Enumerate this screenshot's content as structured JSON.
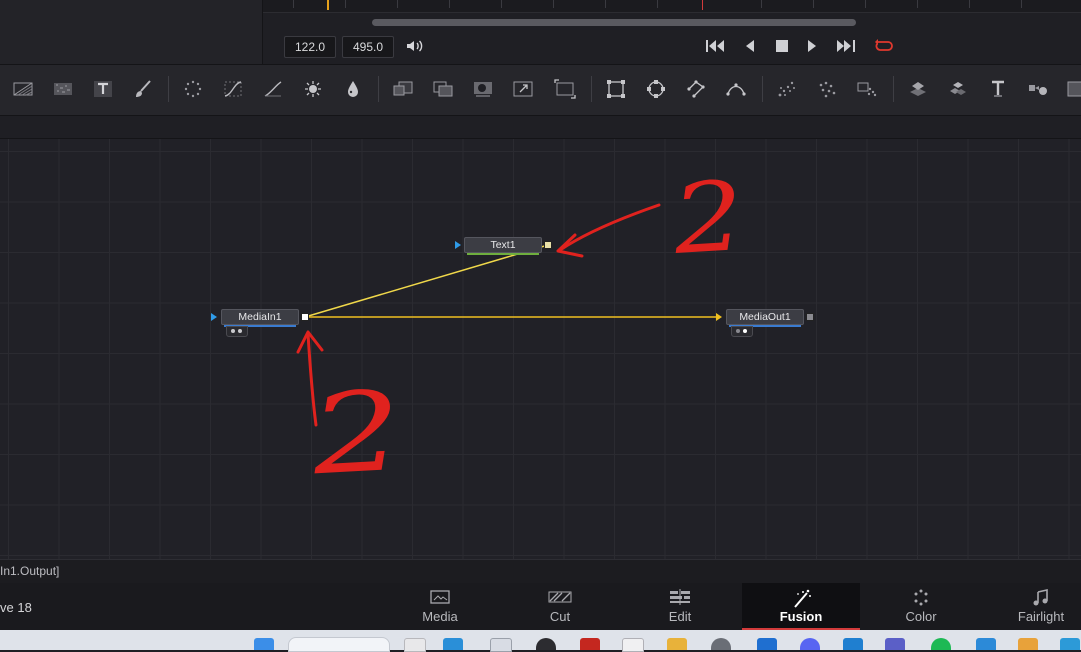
{
  "playback": {
    "current_frame": "122.0",
    "end_frame": "495.0"
  },
  "toolbar": {
    "tools": [
      "background-tool-icon",
      "fast-noise-tool-icon",
      "text-tool-icon",
      "paint-tool-icon",
      "particles-tool-icon",
      "color-curves-tool-icon",
      "color-corrector-tool-icon",
      "brightness-tool-icon",
      "blur-tool-icon",
      "loader-tool-icon",
      "merge-tool-icon",
      "matte-control-tool-icon",
      "transform-tool-icon",
      "resize-tool-icon",
      "rectangle-mask-icon",
      "ellipse-mask-icon",
      "polygon-mask-icon",
      "bspline-mask-icon",
      "particle-emitter-icon",
      "particle-render-icon",
      "particle-stamp-icon",
      "shape3d-tool-icon",
      "merge3d-tool-icon",
      "text3d-tool-icon",
      "camera3d-tool-icon",
      "render3d-tool-icon"
    ]
  },
  "nodes": {
    "text": {
      "label": "Text1"
    },
    "media_in": {
      "label": "MediaIn1"
    },
    "media_out": {
      "label": "MediaOut1"
    }
  },
  "annotations": {
    "top_number": "2",
    "bottom_number": "2"
  },
  "status_bar": {
    "text": "In1.Output]"
  },
  "app": {
    "version_fragment": "ve 18"
  },
  "pages": [
    {
      "label": "Media",
      "icon": "media-page-icon",
      "active": false
    },
    {
      "label": "Cut",
      "icon": "cut-page-icon",
      "active": false
    },
    {
      "label": "Edit",
      "icon": "edit-page-icon",
      "active": false
    },
    {
      "label": "Fusion",
      "icon": "fusion-page-icon",
      "active": true
    },
    {
      "label": "Color",
      "icon": "color-page-icon",
      "active": false
    },
    {
      "label": "Fairlight",
      "icon": "fairlight-page-icon",
      "active": false
    }
  ],
  "colors": {
    "connection_line": "#f0d84a",
    "annotation_red": "#e0221e",
    "active_tab_underline": "#d23b3b",
    "node_input_arrow": "#2f9be8",
    "text_node_underline": "#6fae3e",
    "media_node_underline": "#3a7bd0"
  }
}
